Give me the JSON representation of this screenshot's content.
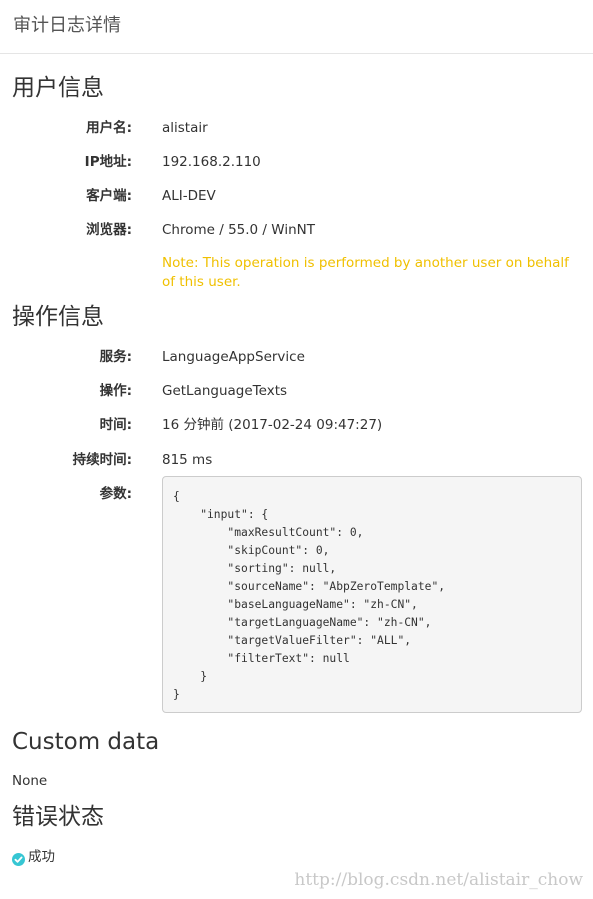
{
  "header": {
    "title": "审计日志详情"
  },
  "user_info": {
    "title": "用户信息",
    "fields": [
      {
        "label": "用户名:",
        "value": "alistair"
      },
      {
        "label": "IP地址:",
        "value": "192.168.2.110"
      },
      {
        "label": "客户端:",
        "value": "ALI-DEV"
      },
      {
        "label": "浏览器:",
        "value": "Chrome / 55.0 / WinNT"
      }
    ],
    "note": "Note: This operation is performed by another user on behalf of this user."
  },
  "action_info": {
    "title": "操作信息",
    "fields": [
      {
        "label": "服务:",
        "value": "LanguageAppService"
      },
      {
        "label": "操作:",
        "value": "GetLanguageTexts"
      },
      {
        "label": "时间:",
        "value": "16 分钟前 (2017-02-24 09:47:27)"
      },
      {
        "label": "持续时间:",
        "value": "815 ms"
      }
    ],
    "params_label": "参数:",
    "params": "{\n    \"input\": {\n        \"maxResultCount\": 0,\n        \"skipCount\": 0,\n        \"sorting\": null,\n        \"sourceName\": \"AbpZeroTemplate\",\n        \"baseLanguageName\": \"zh-CN\",\n        \"targetLanguageName\": \"zh-CN\",\n        \"targetValueFilter\": \"ALL\",\n        \"filterText\": null\n    }\n}"
  },
  "custom_data": {
    "title": "Custom data",
    "value": "None"
  },
  "error_state": {
    "title": "错误状态",
    "status": "成功",
    "status_icon": "check-circle-icon",
    "status_color": "#36c6d3"
  },
  "watermark": "http://blog.csdn.net/alistair_chow"
}
